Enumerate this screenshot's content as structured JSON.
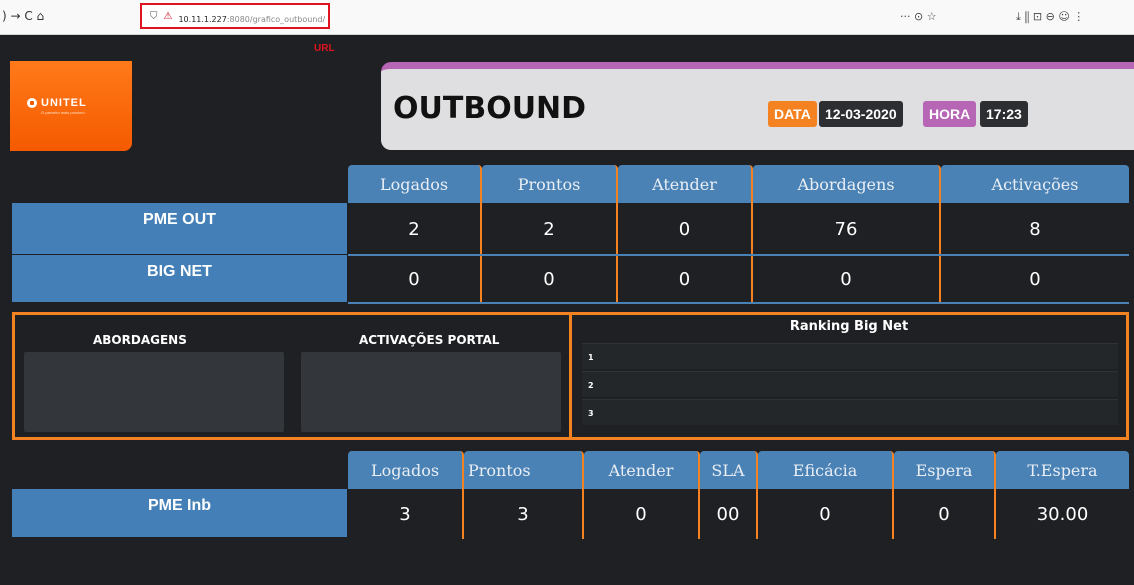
{
  "browser": {
    "nav": ")  →  C  ⌂",
    "url_host": "10.11.1.227",
    "url_rest": ":8080/grafico_outbound/",
    "annotation": "URL",
    "toolbar_left": "···  ⊙  ☆",
    "toolbar_right": "⤓  ⫼  ⊡  ⊖  ☺  ⋮"
  },
  "logo": {
    "word": "UNITEL",
    "tagline": "O parceiro mais próximo."
  },
  "header": {
    "title": "OUTBOUND",
    "data_label": "DATA",
    "date": "12-03-2020",
    "hora_label": "HORA",
    "time": "17:23"
  },
  "top_table": {
    "columns": [
      "Logados",
      "Prontos",
      "Atender",
      "Abordagens",
      "Activações"
    ],
    "rows": [
      {
        "label": "PME OUT",
        "values": [
          "2",
          "2",
          "0",
          "76",
          "8"
        ]
      },
      {
        "label": "BIG NET",
        "values": [
          "0",
          "0",
          "0",
          "0",
          "0"
        ]
      }
    ]
  },
  "middle": {
    "abordagens_label": "ABORDAGENS",
    "portal_label": "ACTIVAÇÕES PORTAL",
    "ranking_title": "Ranking Big Net",
    "ranking_rows": [
      "1",
      "2",
      "3"
    ]
  },
  "bottom_table": {
    "columns": [
      "Logados",
      "Prontos",
      "Atender",
      "SLA",
      "Eficácia",
      "Espera",
      "T.Espera"
    ],
    "rows": [
      {
        "label": "PME Inb",
        "values": [
          "3",
          "3",
          "0",
          "00",
          "0",
          "0",
          "30.00"
        ]
      }
    ]
  },
  "colors": {
    "accent": "#f58220",
    "header_blue": "#4a82b5",
    "purple": "#b766b5",
    "bg": "#1e2023"
  }
}
